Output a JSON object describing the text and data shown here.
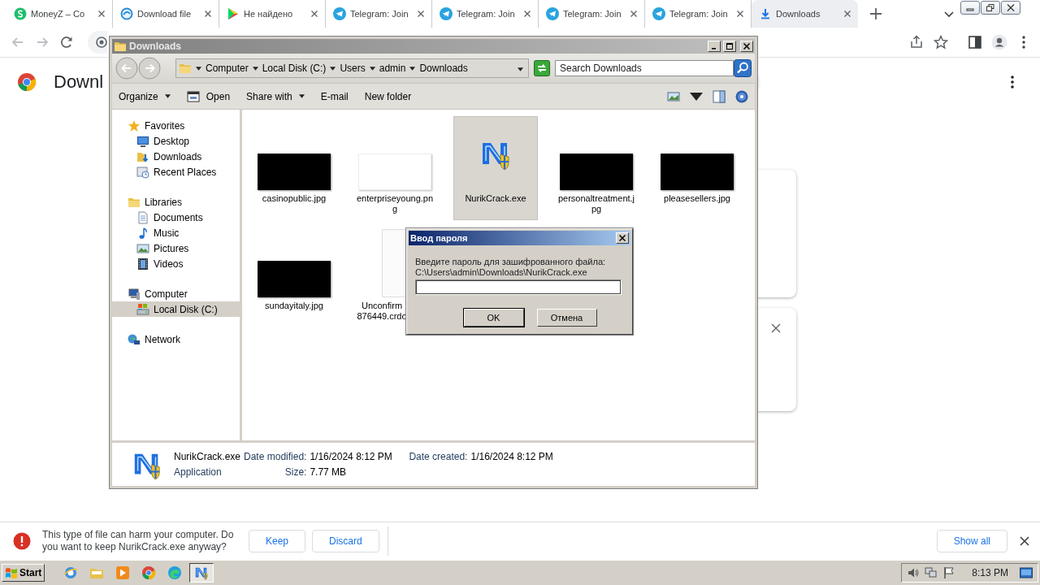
{
  "browser": {
    "tabs": [
      {
        "title": "MoneyZ – Co",
        "selected": false
      },
      {
        "title": "Download file",
        "selected": false
      },
      {
        "title": "Не найдено",
        "selected": false
      },
      {
        "title": "Telegram: Join",
        "selected": false
      },
      {
        "title": "Telegram: Join",
        "selected": false
      },
      {
        "title": "Telegram: Join",
        "selected": false
      },
      {
        "title": "Telegram: Join",
        "selected": false
      },
      {
        "title": "Downloads",
        "selected": true
      }
    ],
    "page": {
      "title": "Downl"
    }
  },
  "explorer": {
    "title": "Downloads",
    "breadcrumbs": [
      "Computer",
      "Local Disk (C:)",
      "Users",
      "admin",
      "Downloads"
    ],
    "search": {
      "placeholder": "Search Downloads"
    },
    "toolbar": [
      {
        "label": "Organize",
        "dropdown": true
      },
      {
        "label": "Open",
        "dropdown": false
      },
      {
        "label": "Share with",
        "dropdown": true
      },
      {
        "label": "E-mail",
        "dropdown": false
      },
      {
        "label": "New folder",
        "dropdown": false
      }
    ],
    "sidebar": [
      {
        "label": "Favorites",
        "selected": false,
        "children": [
          {
            "label": "Desktop",
            "selected": false
          },
          {
            "label": "Downloads",
            "selected": false
          },
          {
            "label": "Recent Places",
            "selected": false
          }
        ]
      },
      {
        "label": "Libraries",
        "selected": false,
        "children": [
          {
            "label": "Documents",
            "selected": false
          },
          {
            "label": "Music",
            "selected": false
          },
          {
            "label": "Pictures",
            "selected": false
          },
          {
            "label": "Videos",
            "selected": false
          }
        ]
      },
      {
        "label": "Computer",
        "selected": false,
        "children": [
          {
            "label": "Local Disk (C:)",
            "selected": true
          }
        ]
      },
      {
        "label": "Network",
        "selected": false
      }
    ],
    "files": [
      {
        "name": "casinopublic.jpg",
        "kind": "dark-image",
        "selected": false
      },
      {
        "name": "enterpriseyoung.png",
        "kind": "light-image",
        "selected": false
      },
      {
        "name": "NurikCrack.exe",
        "kind": "application",
        "selected": true
      },
      {
        "name": "personaltreatment.jpg",
        "kind": "dark-image",
        "selected": false
      },
      {
        "name": "pleasesellers.jpg",
        "kind": "dark-image",
        "selected": false
      },
      {
        "name": "sundayitaly.jpg",
        "kind": "dark-image",
        "selected": false
      },
      {
        "name": "Unconfirm 876449.crdo",
        "kind": "partial-document",
        "selected": false
      }
    ],
    "details": {
      "name": "NurikCrack.exe",
      "type": "Application",
      "fields": [
        {
          "label": "Date modified:",
          "value": "1/16/2024 8:12 PM"
        },
        {
          "label": "Size:",
          "value": "7.77 MB"
        },
        {
          "label": "Date created:",
          "value": "1/16/2024 8:12 PM"
        }
      ]
    }
  },
  "dialog": {
    "title": "Ввод пароля",
    "prompt": "Введите пароль для зашифрованного файла:",
    "path": "C:\\Users\\admin\\Downloads\\NurikCrack.exe",
    "buttons": [
      {
        "label": "OK",
        "default": true
      },
      {
        "label": "Отмена",
        "default": false
      }
    ]
  },
  "download_bar": {
    "message": "This type of file can harm your computer. Do you want to keep NurikCrack.exe anyway?",
    "buttons": [
      "Keep",
      "Discard"
    ],
    "show_all": "Show all"
  },
  "taskbar": {
    "start": "Start",
    "time": "8:13 PM"
  }
}
